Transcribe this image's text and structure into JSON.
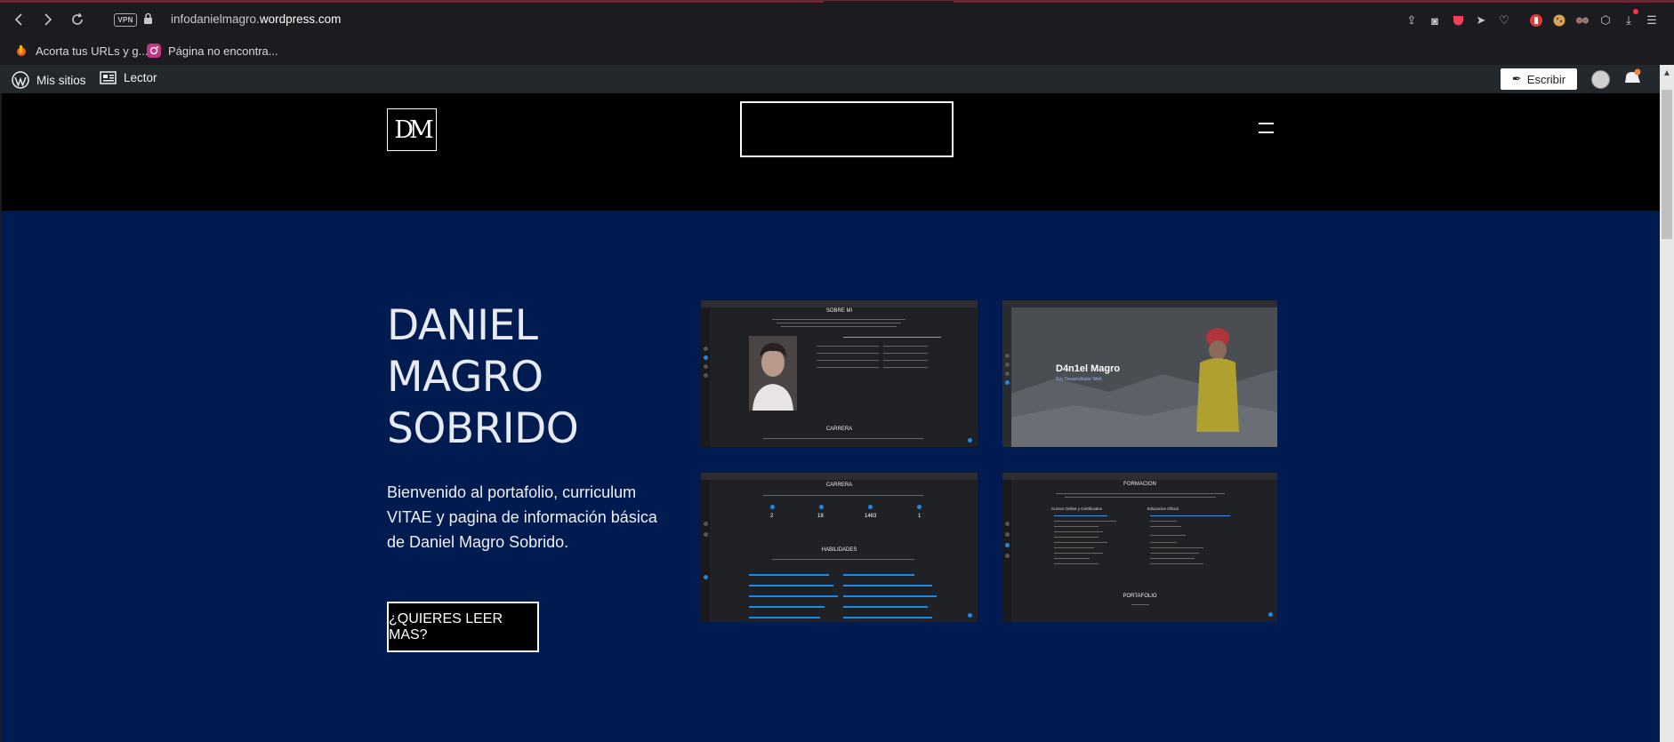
{
  "browser": {
    "url_prefix": "infodanielmagro.",
    "url_domain": "wordpress.com",
    "vpn_label": "VPN"
  },
  "bookmarks": [
    {
      "label": "Acorta tus URLs y g..."
    },
    {
      "label": "Página no encontra..."
    }
  ],
  "wp_admin_bar": {
    "my_sites": "Mis sitios",
    "reader": "Lector",
    "write": "Escribir"
  },
  "hero": {
    "title_line1": "DANIEL",
    "title_line2": "MAGRO",
    "title_line3": "SOBRIDO",
    "description": "Bienvenido al portafolio, curriculum VITAE y pagina de información básica de Daniel Magro Sobrido.",
    "button_label": "¿QUIERES LEER MAS?"
  },
  "logo_text": "DM",
  "screenshots": {
    "sobre_mi_title": "SOBRE MI",
    "carrera_label": "CARRERA",
    "intro_name": "D4n1el Magro",
    "intro_sub": "Soy Desarrollador Web",
    "carrera_title": "CARRERA",
    "stats": [
      "2",
      "18",
      "1463",
      "1"
    ],
    "habilidades_title": "HABILIDADES",
    "formacion_title": "FORMACION",
    "formacion_col1": "Cursos Online y Certificados",
    "formacion_col2": "Educacion Oficial",
    "portafolio_title": "PORTAFOLIO"
  },
  "colors": {
    "hero_bg": "#001b4f",
    "header_bg": "#000000",
    "wpbar_bg": "#23282d",
    "accent_blue": "#1e88e5"
  }
}
